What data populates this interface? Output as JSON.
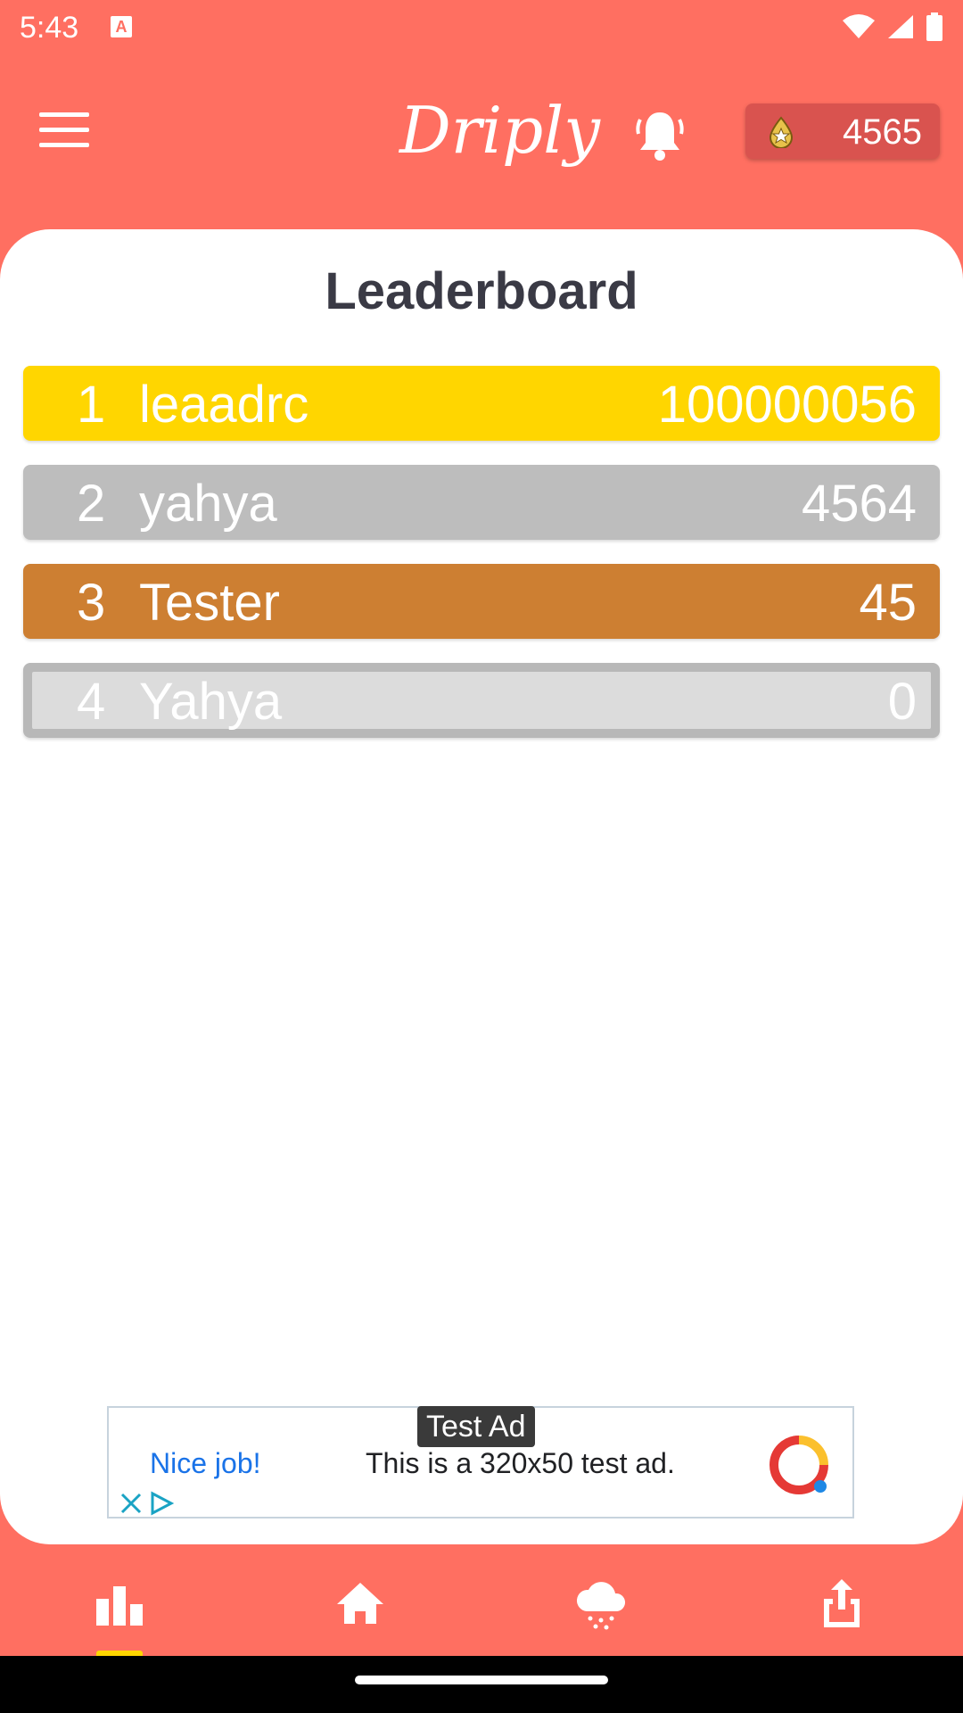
{
  "status_bar": {
    "time": "5:43",
    "notification_icon": "A",
    "icons": [
      "wifi-icon",
      "signal-icon",
      "battery-icon"
    ]
  },
  "app_bar": {
    "title": "Driply",
    "coins": "4565",
    "icons": [
      "menu-icon",
      "bell-icon",
      "coin-icon"
    ]
  },
  "leaderboard": {
    "title": "Leaderboard",
    "rows": [
      {
        "rank": "1",
        "name": "leaadrc",
        "score": "100000056",
        "color": "#FFD600"
      },
      {
        "rank": "2",
        "name": "yahya",
        "score": "4564",
        "color": "#BDBDBD"
      },
      {
        "rank": "3",
        "name": "Tester",
        "score": "45",
        "color": "#CD7F32"
      },
      {
        "rank": "4",
        "name": "Yahya",
        "score": "0",
        "color": "#DCDCDC"
      }
    ]
  },
  "ad": {
    "badge": "Test Ad",
    "headline": "Nice job!",
    "text": "This is a 320x50 test ad."
  },
  "bottom_nav": {
    "items": [
      "leaderboard-icon",
      "home-icon",
      "weather-icon",
      "share-icon"
    ],
    "active": "leaderboard-icon"
  },
  "colors": {
    "background": "#FF6F61",
    "card": "#FFFFFF",
    "accent": "#FFD600"
  }
}
